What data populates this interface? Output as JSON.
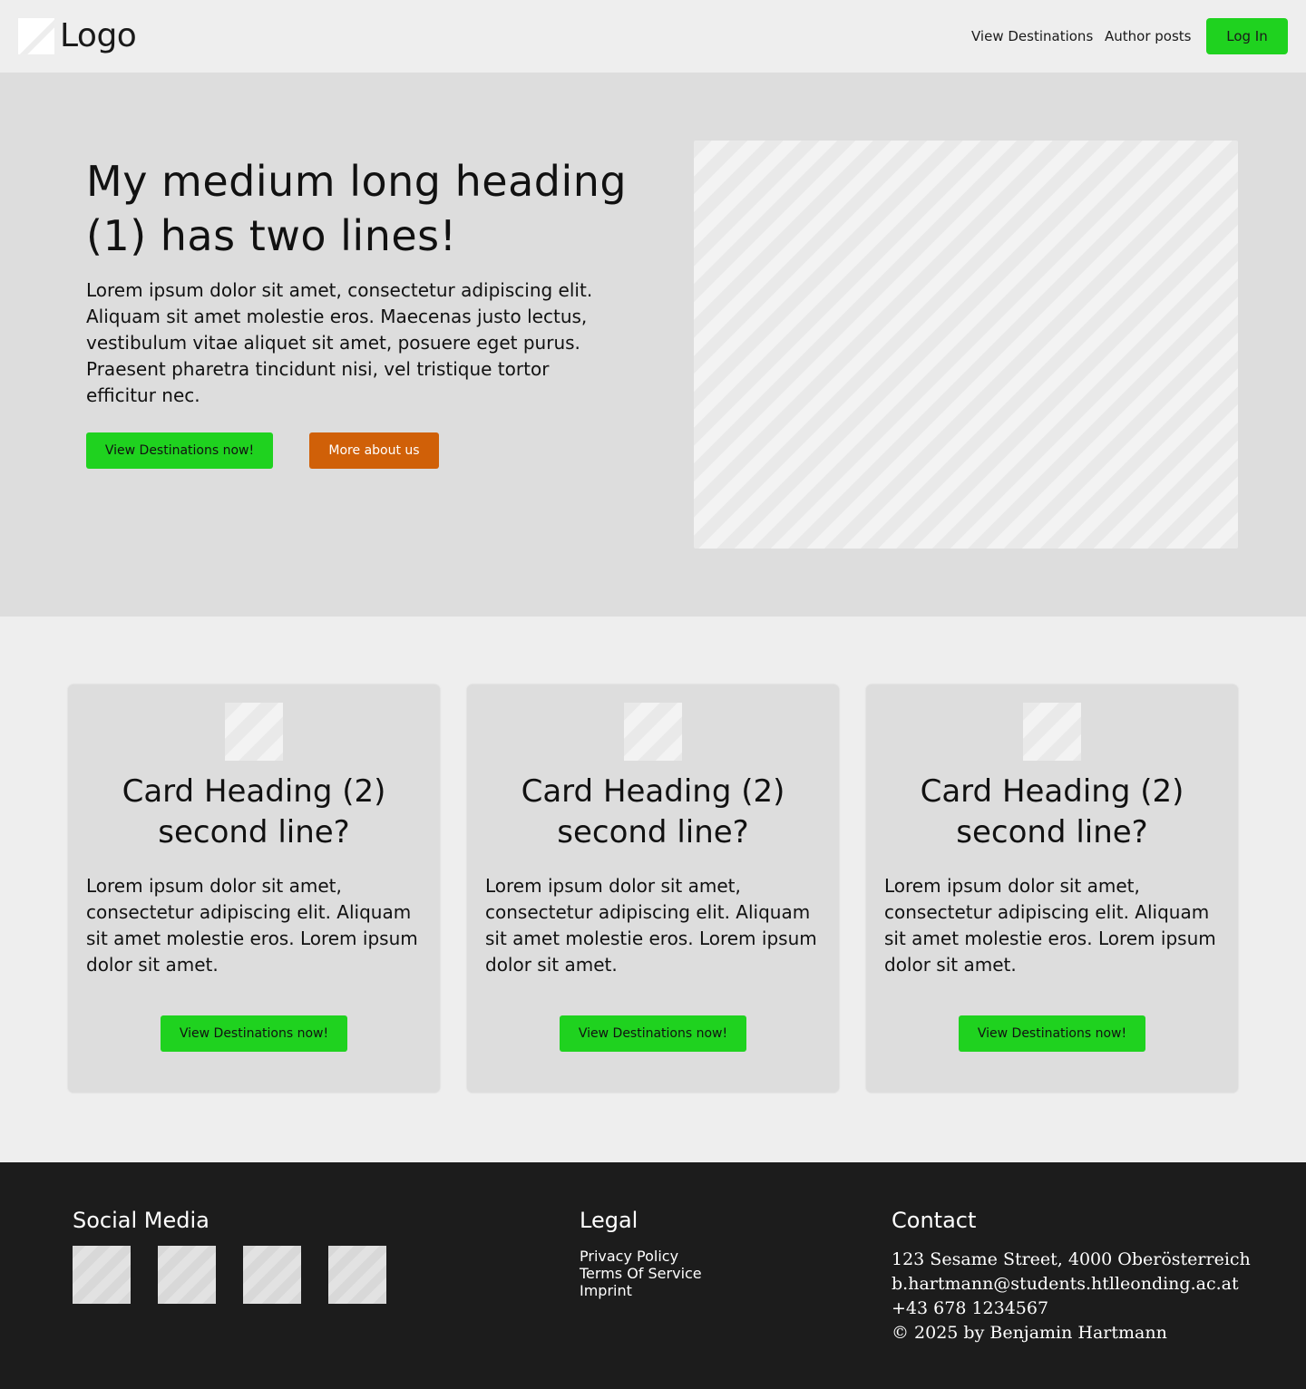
{
  "header": {
    "logo_text": "Logo",
    "nav": [
      {
        "label": "View Destinations"
      },
      {
        "label": "Author posts"
      }
    ],
    "login_label": "Log In"
  },
  "hero": {
    "title": "My medium long heading (1) has two lines!",
    "text": "Lorem ipsum dolor sit amet, consectetur adipiscing elit. Aliquam sit  amet molestie eros. Maecenas justo lectus, vestibulum vitae aliquet sit  amet, posuere eget purus. Praesent pharetra tincidunt nisi, vel tristique tortor efficitur nec.",
    "primary_button": "View Destinations now!",
    "secondary_button": "More about us"
  },
  "cards": [
    {
      "title": "Card Heading (2) second line?",
      "text": "Lorem ipsum dolor sit amet, consectetur adipiscing elit. Aliquam sit  amet molestie eros. Lorem ipsum dolor sit amet.",
      "button": "View Destinations now!"
    },
    {
      "title": "Card Heading (2) second line?",
      "text": "Lorem ipsum dolor sit amet, consectetur adipiscing elit. Aliquam sit  amet molestie eros. Lorem ipsum dolor sit amet.",
      "button": "View Destinations now!"
    },
    {
      "title": "Card Heading (2) second line?",
      "text": "Lorem ipsum dolor sit amet, consectetur adipiscing elit. Aliquam sit  amet molestie eros. Lorem ipsum dolor sit amet.",
      "button": "View Destinations now!"
    }
  ],
  "footer": {
    "social_heading": "Social Media",
    "legal_heading": "Legal",
    "legal_links": [
      "Privacy Policy",
      "Terms Of Service",
      "Imprint"
    ],
    "contact_heading": "Contact",
    "contact_lines": [
      "123 Sesame Street, 4000 Oberösterreich",
      "b.hartmann@students.htlleonding.ac.at",
      "+43 678 1234567",
      "© 2025 by Benjamin Hartmann"
    ]
  },
  "colors": {
    "accent_green": "#1fd21f",
    "accent_orange": "#d06008",
    "footer_bg": "#1c1c1c",
    "hero_bg": "#dddddd",
    "page_bg": "#eeeeee"
  }
}
